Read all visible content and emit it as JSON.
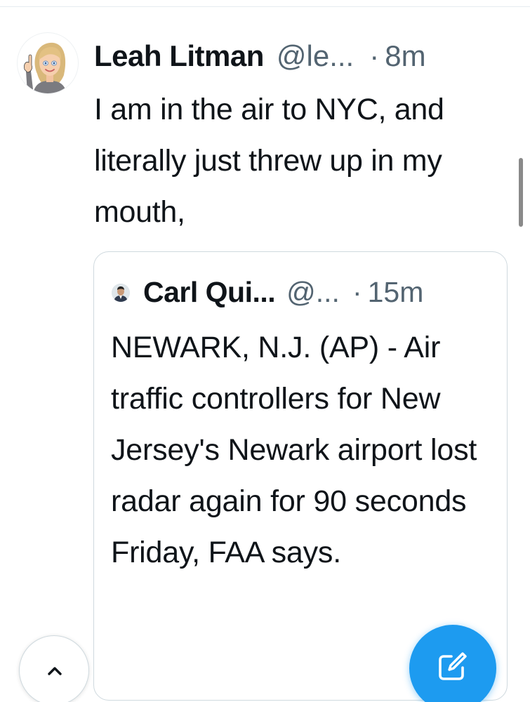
{
  "tweet": {
    "author_name": "Leah Litman",
    "author_handle": "@le...",
    "separator": "·",
    "time": "8m",
    "text": "I am in the air to NYC, and literally just threw up in my mouth,",
    "avatar_icon": "bitmoji-avatar-icon",
    "quoted": {
      "author_name": "Carl Qui...",
      "author_handle": "@...",
      "separator": "·",
      "time": "15m",
      "text": "NEWARK, N.J. (AP) - Air traffic controllers for New Jersey's Newark airport lost radar again for 90 seconds Friday, FAA says.",
      "avatar_icon": "profile-photo-icon"
    }
  },
  "controls": {
    "scroll_top_icon": "chevron-up-icon",
    "compose_icon": "compose-icon"
  },
  "colors": {
    "accent": "#1d9bf0",
    "text_primary": "#0f1419",
    "text_secondary": "#536471",
    "border": "#cfd9de"
  }
}
